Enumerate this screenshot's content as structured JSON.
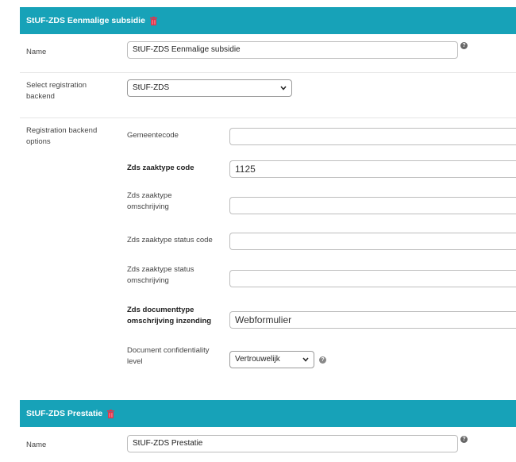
{
  "sections": [
    {
      "title": "StUF-ZDS Eenmalige subsidie",
      "name_label": "Name",
      "name_value": "StUF-ZDS Eenmalige subsidie",
      "backend_label": "Select registration backend",
      "backend_value": "StUF-ZDS",
      "options_label": "Registration backend options",
      "options": {
        "gemeentecode": {
          "label": "Gemeentecode",
          "value": ""
        },
        "zaaktype_code": {
          "label": "Zds zaaktype code",
          "value": "1125"
        },
        "zaaktype_omschrijving": {
          "label": "Zds zaaktype omschrijving",
          "value": ""
        },
        "status_code": {
          "label": "Zds zaaktype status code",
          "value": ""
        },
        "status_omschrijving": {
          "label": "Zds zaaktype status omschrijving",
          "value": ""
        },
        "documenttype": {
          "label": "Zds documenttype omschrijving inzending",
          "value": "Webformulier"
        },
        "confidentiality": {
          "label": "Document confidentiality level",
          "value": "Vertrouwelijk"
        }
      }
    },
    {
      "title": "StUF-ZDS Prestatie",
      "name_label": "Name",
      "name_value": "StUF-ZDS Prestatie"
    }
  ],
  "icons": {
    "trash": "trash-icon",
    "help": "question-mark-icon",
    "chevron": "chevron-down-icon"
  },
  "colors": {
    "header_bg": "#17a2b8",
    "trash": "#e0334a"
  }
}
